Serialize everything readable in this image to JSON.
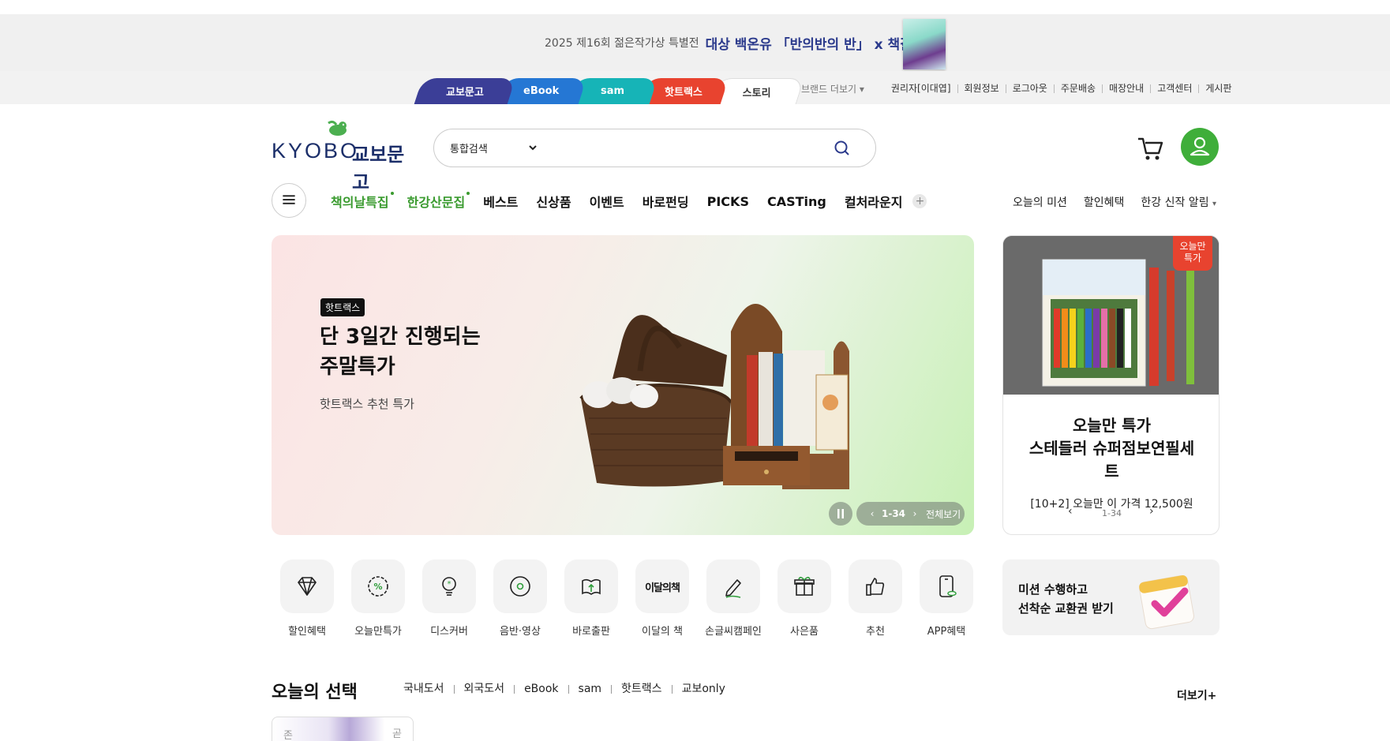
{
  "promo": {
    "prefix": "2025 제16회 젊은작가상 특별전",
    "emphasis": "대상 백온유 「반의반의 반」 x 책갈피"
  },
  "brand_tabs": [
    "교보문고",
    "eBook",
    "sam",
    "핫트랙스",
    "스토리"
  ],
  "utility": {
    "brand_more": "브랜드 더보기",
    "links": [
      "권리자[이대엽]",
      "회원정보",
      "로그아웃",
      "주문배송",
      "매장안내",
      "고객센터",
      "게시판"
    ]
  },
  "logo": {
    "word": "KYOBO",
    "kor": "교보문고"
  },
  "search": {
    "scope": "통합검색",
    "value": ""
  },
  "gnb": {
    "green_items": [
      "책의날특집",
      "한강산문집"
    ],
    "items": [
      "베스트",
      "신상품",
      "이벤트",
      "바로펀딩",
      "PICKS",
      "CASTing",
      "컬처라운지"
    ],
    "plus": "+",
    "right": [
      "오늘의 미션",
      "할인혜택",
      "한강 신작 알림"
    ]
  },
  "hero": {
    "badge": "핫트랙스",
    "title_line1": "단 3일간 진행되는",
    "title_line2": "주말특가",
    "subtitle": "핫트랙스 추천 특가",
    "pager": "1-34",
    "view_all": "전체보기"
  },
  "side_card": {
    "tag_line1": "오늘만",
    "tag_line2": "특가",
    "title_line1": "오늘만 특가",
    "title_line2": "스테들러 슈퍼점보연필세",
    "title_line3": "트",
    "price": "[10+2] 오늘만 이 가격 12,500원",
    "pager": "1-34"
  },
  "quick_menu": [
    {
      "label": "할인혜택",
      "icon": "diamond-icon"
    },
    {
      "label": "오늘만특가",
      "icon": "percent-badge-icon"
    },
    {
      "label": "디스커버",
      "icon": "bulb-icon"
    },
    {
      "label": "음반·영상",
      "icon": "disc-icon"
    },
    {
      "label": "바로출판",
      "icon": "book-upload-icon"
    },
    {
      "label": "이달의 책",
      "icon": "month-book-icon",
      "icon_text": "이달의책"
    },
    {
      "label": "손글씨캠페인",
      "icon": "pencil-icon"
    },
    {
      "label": "사은품",
      "icon": "gift-icon"
    },
    {
      "label": "추천",
      "icon": "thumbs-up-icon"
    },
    {
      "label": "APP혜택",
      "icon": "phone-icon"
    }
  ],
  "mission": {
    "line1": "미션 수행하고",
    "line2": "선착순 교환권 받기"
  },
  "today": {
    "title": "오늘의 선택",
    "tabs": [
      "국내도서",
      "외국도서",
      "eBook",
      "sam",
      "핫트랙스",
      "교보only"
    ],
    "more": "더보기+",
    "thumb_left": "존",
    "thumb_right": "곧"
  },
  "colors": {
    "brand_green": "#3fae3a",
    "navy": "#1c2f6a",
    "accent_red": "#e8432f"
  }
}
